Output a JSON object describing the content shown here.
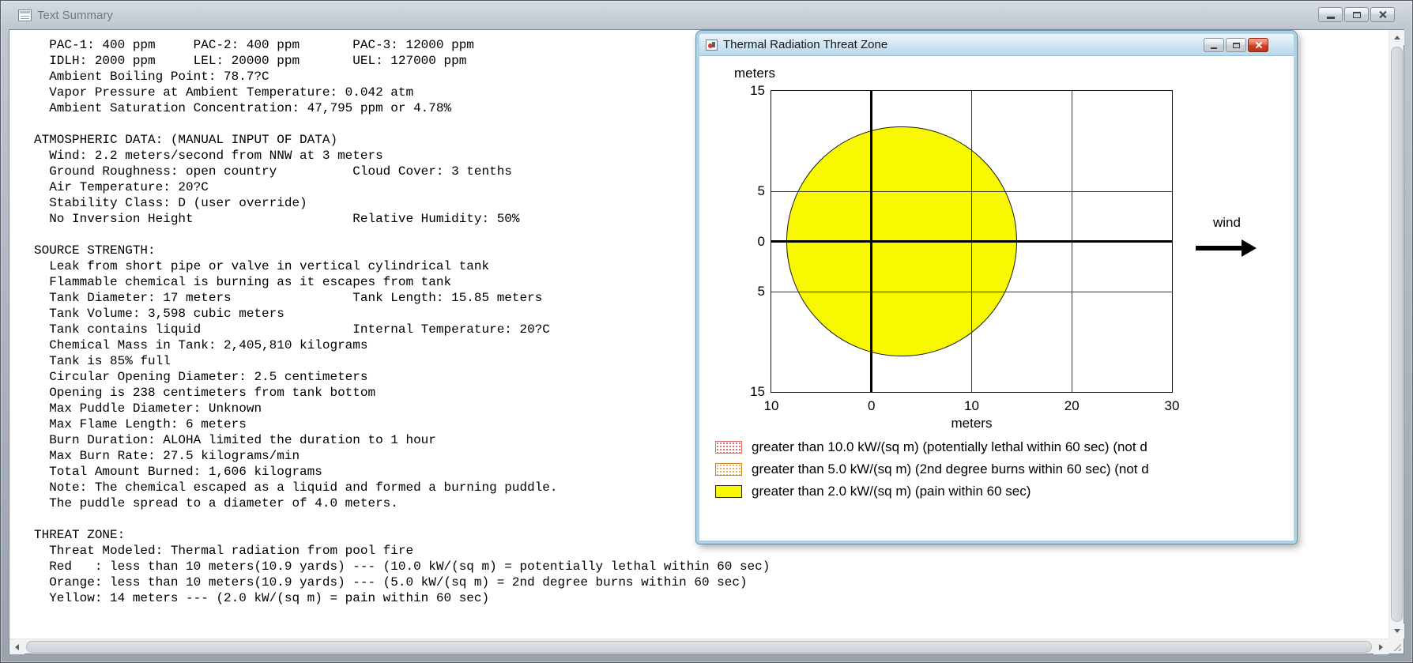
{
  "main_window": {
    "title": "Text Summary"
  },
  "text_summary": {
    "content": "  PAC-1: 400 ppm     PAC-2: 400 ppm       PAC-3: 12000 ppm\n  IDLH: 2000 ppm     LEL: 20000 ppm       UEL: 127000 ppm\n  Ambient Boiling Point: 78.7?C\n  Vapor Pressure at Ambient Temperature: 0.042 atm\n  Ambient Saturation Concentration: 47,795 ppm or 4.78%\n\nATMOSPHERIC DATA: (MANUAL INPUT OF DATA)\n  Wind: 2.2 meters/second from NNW at 3 meters\n  Ground Roughness: open country          Cloud Cover: 3 tenths\n  Air Temperature: 20?C\n  Stability Class: D (user override)\n  No Inversion Height                     Relative Humidity: 50%\n\nSOURCE STRENGTH:\n  Leak from short pipe or valve in vertical cylindrical tank\n  Flammable chemical is burning as it escapes from tank\n  Tank Diameter: 17 meters                Tank Length: 15.85 meters\n  Tank Volume: 3,598 cubic meters\n  Tank contains liquid                    Internal Temperature: 20?C\n  Chemical Mass in Tank: 2,405,810 kilograms\n  Tank is 85% full\n  Circular Opening Diameter: 2.5 centimeters\n  Opening is 238 centimeters from tank bottom\n  Max Puddle Diameter: Unknown\n  Max Flame Length: 6 meters\n  Burn Duration: ALOHA limited the duration to 1 hour\n  Max Burn Rate: 27.5 kilograms/min\n  Total Amount Burned: 1,606 kilograms\n  Note: The chemical escaped as a liquid and formed a burning puddle.\n  The puddle spread to a diameter of 4.0 meters.\n\nTHREAT ZONE:\n  Threat Modeled: Thermal radiation from pool fire\n  Red   : less than 10 meters(10.9 yards) --- (10.0 kW/(sq m) = potentially lethal within 60 sec)\n  Orange: less than 10 meters(10.9 yards) --- (5.0 kW/(sq m) = 2nd degree burns within 60 sec)\n  Yellow: 14 meters --- (2.0 kW/(sq m) = pain within 60 sec)"
  },
  "threat_window": {
    "title": "Thermal Radiation Threat Zone"
  },
  "chart_data": {
    "type": "area",
    "title": "Thermal Radiation Threat Zone",
    "xlabel": "meters",
    "ylabel": "meters",
    "xlim": [
      -10,
      30
    ],
    "ylim": [
      -15,
      15
    ],
    "grid": "on",
    "x_ticks": [
      {
        "v": -10,
        "label": "10"
      },
      {
        "v": 0,
        "label": "0"
      },
      {
        "v": 10,
        "label": "10"
      },
      {
        "v": 20,
        "label": "20"
      },
      {
        "v": 30,
        "label": "30"
      }
    ],
    "y_ticks": [
      {
        "v": 15,
        "label": "15"
      },
      {
        "v": 5,
        "label": "5"
      },
      {
        "v": 0,
        "label": "0"
      },
      {
        "v": -5,
        "label": "5"
      },
      {
        "v": -15,
        "label": "15"
      }
    ],
    "x_grid": [
      10,
      20
    ],
    "y_grid": [
      5,
      -5
    ],
    "zones": [
      {
        "name": "yellow-threat-zone",
        "shape": "circle",
        "center_x": 3,
        "center_y": 0,
        "radius": 11.5,
        "fill": "#f8f800",
        "outline": "#1a1a1a"
      }
    ],
    "wind_label": "wind",
    "legend": [
      {
        "swatch": "red-stipple",
        "color": "#dd4040",
        "label": "greater than 10.0 kW/(sq m) (potentially lethal within 60 sec) (not d"
      },
      {
        "swatch": "orange-stipple",
        "color": "#e89a2e",
        "label": "greater than 5.0 kW/(sq m) (2nd degree burns within 60 sec) (not d"
      },
      {
        "swatch": "yellow-solid",
        "color": "#f8f800",
        "label": "greater than 2.0 kW/(sq m) (pain within 60 sec)"
      }
    ]
  }
}
